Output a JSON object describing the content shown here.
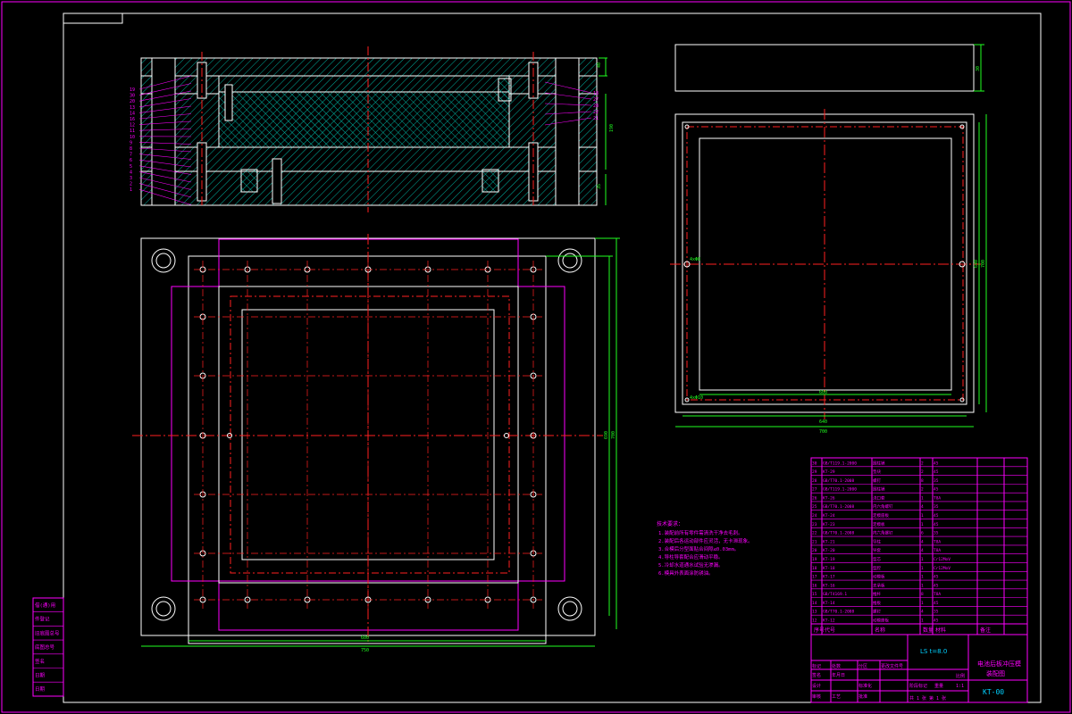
{
  "colors": {
    "background": "#000000",
    "frame": "#ff00ff",
    "outline": "#ffffff",
    "hatch": "#00b0a0",
    "center_line": "#ff2020",
    "dimension": "#20ff20",
    "text": "#ff00ff",
    "title_text": "#00d0ff"
  },
  "section_view": {
    "left_callouts": [
      "19",
      "30",
      "20",
      "13",
      "14",
      "16",
      "12",
      "11",
      "10",
      "9",
      "8",
      "7",
      "6",
      "5",
      "4",
      "3",
      "2",
      "1"
    ],
    "right_callouts": [
      "18",
      "27",
      "28",
      "22",
      "21"
    ],
    "dims": [
      "40",
      "190",
      "35"
    ]
  },
  "plan_view": {
    "dims": [
      "600",
      "750",
      "690",
      "700"
    ]
  },
  "plate_views": {
    "top_dim": "30",
    "inner_width": "600",
    "outer_width": "640",
    "bottom_dim": "700",
    "side_dims": [
      "640",
      "700"
    ],
    "hole_labels": [
      "4xΦ8",
      "4xΦ10"
    ]
  },
  "tech_notes": {
    "title": "技术要求：",
    "items": [
      "1.装配前所有零件需清洗干净去毛刺。",
      "2.装配后各运动部件应灵活，无卡滞现象。",
      "3.合模后分型面贴合间隙≤0.03mm。",
      "4.导柱导套配合应滑动平稳。",
      "5.冷却水道通水试验无渗漏。",
      "6.模具外表面涂防锈油。"
    ]
  },
  "bom": {
    "rows": [
      [
        "30",
        "GB/T119.1-2000",
        "圆柱销",
        "2",
        "45",
        ""
      ],
      [
        "29",
        "KT-29",
        "垫块",
        "2",
        "45",
        ""
      ],
      [
        "28",
        "GB/T70.1-2008",
        "螺钉",
        "8",
        "35",
        ""
      ],
      [
        "27",
        "GB/T119.1-2000",
        "圆柱销",
        "2",
        "45",
        ""
      ],
      [
        "26",
        "KT-26",
        "浇口套",
        "1",
        "T8A",
        ""
      ],
      [
        "25",
        "GB/T70.1-2008",
        "内六角螺钉",
        "4",
        "35",
        ""
      ],
      [
        "24",
        "KT-24",
        "定模座板",
        "1",
        "45",
        ""
      ],
      [
        "23",
        "KT-23",
        "定模板",
        "1",
        "45",
        ""
      ],
      [
        "22",
        "GB/T70.1-2008",
        "内六角螺钉",
        "6",
        "35",
        ""
      ],
      [
        "21",
        "KT-21",
        "导柱",
        "4",
        "T8A",
        ""
      ],
      [
        "20",
        "KT-20",
        "导套",
        "4",
        "T8A",
        ""
      ],
      [
        "19",
        "KT-19",
        "型芯",
        "1",
        "Cr12MoV",
        ""
      ],
      [
        "18",
        "KT-18",
        "型腔",
        "1",
        "Cr12MoV",
        ""
      ],
      [
        "17",
        "KT-17",
        "动模板",
        "1",
        "45",
        ""
      ],
      [
        "16",
        "KT-16",
        "支承板",
        "1",
        "45",
        ""
      ],
      [
        "15",
        "GB/T4169.1",
        "推杆",
        "8",
        "T8A",
        ""
      ],
      [
        "14",
        "KT-14",
        "推板",
        "1",
        "45",
        ""
      ],
      [
        "13",
        "GB/T70.1-2008",
        "螺钉",
        "4",
        "35",
        ""
      ],
      [
        "12",
        "KT-12",
        "动模座板",
        "1",
        "45",
        ""
      ]
    ],
    "header": [
      "序号",
      "代号",
      "名称",
      "数量",
      "材料",
      "备注"
    ]
  },
  "title_block": {
    "scale_text": "LS  t=8.0",
    "drawing_title_1": "电池后板冲压模",
    "drawing_title_2": "装配图",
    "drawing_number": "KT-00",
    "scale": "1:1",
    "sheet_text": "共 1 张  第 1 张",
    "labels": [
      "标记",
      "处数",
      "分区",
      "更改文件号",
      "签名",
      "年月日",
      "设计",
      "标准化",
      "审核",
      "工艺",
      "批准",
      "阶段标记",
      "重量",
      "比例"
    ]
  },
  "side_stamp": [
    "借(通)用",
    "件登记",
    "旧底图总号",
    "底图总号",
    "签名",
    "日期",
    "日期"
  ]
}
